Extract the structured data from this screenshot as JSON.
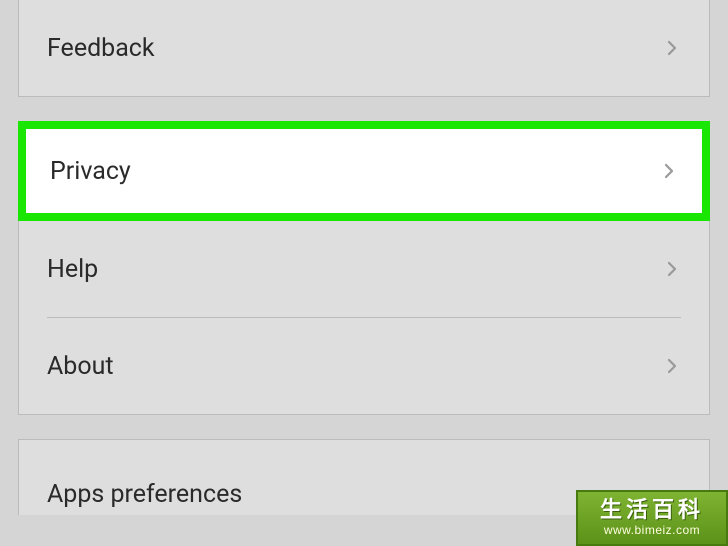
{
  "rows": {
    "feedback": {
      "label": "Feedback"
    },
    "privacy": {
      "label": "Privacy"
    },
    "help": {
      "label": "Help"
    },
    "about": {
      "label": "About"
    },
    "apps_preferences": {
      "label": "Apps preferences"
    }
  },
  "watermark": {
    "title": "生活百科",
    "url": "www.bimeiz.com"
  }
}
